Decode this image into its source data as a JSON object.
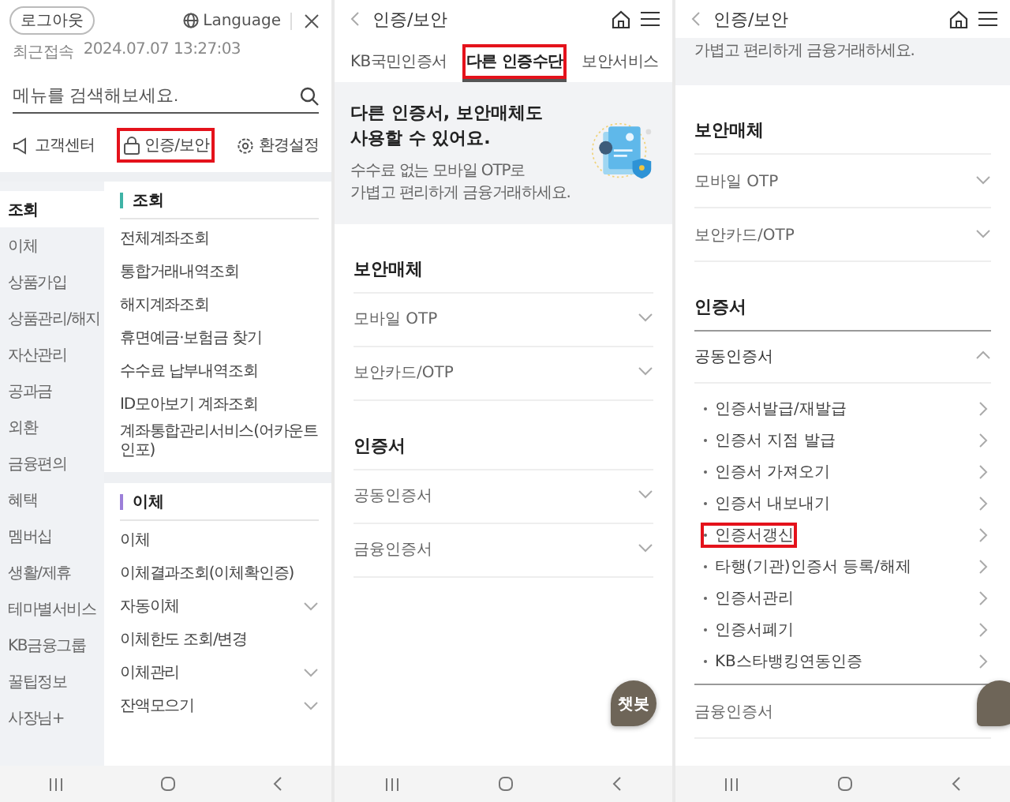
{
  "menu_screen": {
    "logout_button": "로그아웃",
    "language_button": "Language",
    "last_login_label": "최근접속",
    "last_login": "2024.07.07 13:27:03",
    "search": {
      "placeholder": "메뉴를 검색해보세요."
    },
    "quick_links": [
      {
        "kind": "support",
        "label": "고객센터",
        "highlighted": false
      },
      {
        "kind": "security",
        "label": "인증/보안",
        "highlighted": true
      },
      {
        "kind": "settings",
        "label": "환경설정",
        "highlighted": false
      }
    ],
    "sidebar": [
      {
        "label": "조회",
        "selected": true
      },
      {
        "label": "이체",
        "selected": false
      },
      {
        "label": "상품가입",
        "selected": false
      },
      {
        "label": "상품관리/해지",
        "selected": false
      },
      {
        "label": "자산관리",
        "selected": false
      },
      {
        "label": "공과금",
        "selected": false
      },
      {
        "label": "외환",
        "selected": false
      },
      {
        "label": "금융편의",
        "selected": false
      },
      {
        "label": "혜택",
        "selected": false
      },
      {
        "label": "멤버십",
        "selected": false
      },
      {
        "label": "생활/제휴",
        "selected": false
      },
      {
        "label": "테마별서비스",
        "selected": false
      },
      {
        "label": "KB금융그룹",
        "selected": false
      },
      {
        "label": "꿀팁정보",
        "selected": false
      },
      {
        "label": "사장님+",
        "selected": false
      }
    ],
    "sections": [
      {
        "title": "조회",
        "color": "#3fb3a6",
        "items": [
          {
            "kind": "link",
            "label": "전체계좌조회"
          },
          {
            "kind": "link",
            "label": "통합거래내역조회"
          },
          {
            "kind": "link",
            "label": "해지계좌조회"
          },
          {
            "kind": "link",
            "label": "휴면예금·보험금 찾기"
          },
          {
            "kind": "link",
            "label": "수수료 납부내역조회"
          },
          {
            "kind": "link",
            "label": "ID모아보기 계좌조회"
          },
          {
            "kind": "link",
            "label": "계좌통합관리서비스(어카운트인포)"
          }
        ]
      },
      {
        "title": "이체",
        "color": "#9c7fd9",
        "items": [
          {
            "kind": "link",
            "label": "이체"
          },
          {
            "kind": "link",
            "label": "이체결과조회(이체확인증)"
          },
          {
            "kind": "group",
            "label": "자동이체"
          },
          {
            "kind": "link",
            "label": "이체한도 조회/변경"
          },
          {
            "kind": "group",
            "label": "이체관리"
          },
          {
            "kind": "group",
            "label": "잔액모으기"
          }
        ]
      }
    ]
  },
  "auth_screens": [
    {
      "title": "인증/보안",
      "tabs": [
        {
          "label": "KB국민인증서",
          "selected": false,
          "highlighted": false
        },
        {
          "label": "다른 인증수단",
          "selected": true,
          "highlighted": true
        },
        {
          "label": "보안서비스",
          "selected": false,
          "highlighted": false
        }
      ],
      "banner": {
        "title_lines": [
          "다른 인증서, 보안매체도",
          "사용할 수 있어요."
        ],
        "subtitle_lines": [
          "수수료 없는 모바일 OTP로",
          "가볍고 편리하게 금융거래하세요."
        ]
      },
      "sections": [
        {
          "title": "보안매체",
          "items": [
            {
              "label": "모바일 OTP",
              "expanded": false
            },
            {
              "label": "보안카드/OTP",
              "expanded": false
            }
          ]
        },
        {
          "title": "인증서",
          "items": [
            {
              "label": "공동인증서",
              "expanded": false
            },
            {
              "label": "금융인증서",
              "expanded": false
            }
          ]
        }
      ],
      "chatbot": {
        "label": "챗봇",
        "cut": false
      }
    },
    {
      "title": "인증/보안",
      "banner": {
        "subtitle_lines": [
          "가볍고 편리하게 금융거래하세요."
        ]
      },
      "sections": [
        {
          "title": "보안매체",
          "items": [
            {
              "label": "모바일 OTP",
              "expanded": false
            },
            {
              "label": "보안카드/OTP",
              "expanded": false
            }
          ]
        },
        {
          "title": "인증서",
          "items": [
            {
              "label": "공동인증서",
              "expanded": true,
              "children": [
                {
                  "label": "인증서발급/재발급",
                  "highlighted": false
                },
                {
                  "label": "인증서 지점 발급",
                  "highlighted": false
                },
                {
                  "label": "인증서 가져오기",
                  "highlighted": false
                },
                {
                  "label": "인증서 내보내기",
                  "highlighted": false
                },
                {
                  "label": "인증서갱신",
                  "highlighted": true
                },
                {
                  "label": "타행(기관)인증서 등록/해제",
                  "highlighted": false
                },
                {
                  "label": "인증서관리",
                  "highlighted": false
                },
                {
                  "label": "인증서폐기",
                  "highlighted": false
                },
                {
                  "label": "KB스타뱅킹연동인증",
                  "highlighted": false
                }
              ]
            },
            {
              "label": "금융인증서",
              "expanded": false
            }
          ]
        }
      ],
      "chatbot": {
        "cut": true
      }
    }
  ]
}
